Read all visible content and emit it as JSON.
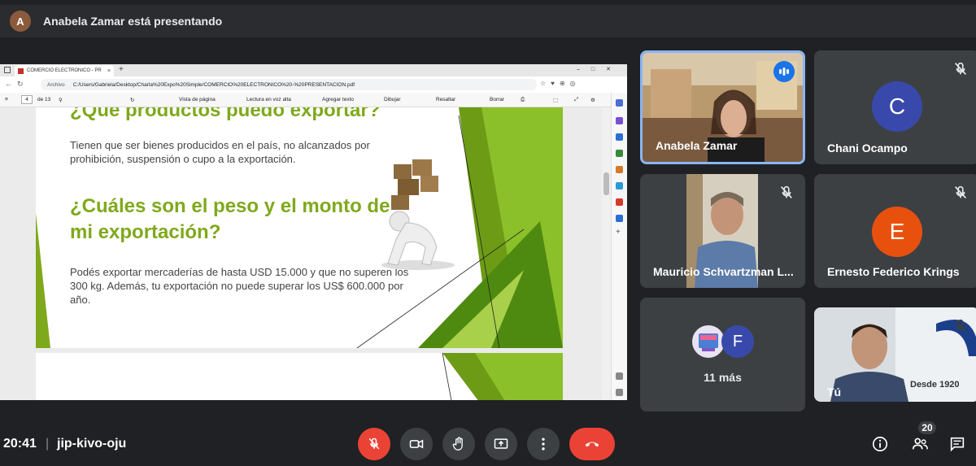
{
  "banner": {
    "avatar_initial": "A",
    "text": "Anabela Zamar está presentando"
  },
  "browser": {
    "tab_title": "COMERCIO ELECTRONICO - PR",
    "tab_close": "×",
    "new_tab": "+",
    "address_label": "Archivo",
    "url": "C:/Users/Gabriela/Desktop/Charla%20Expo%20Simple/COMERCIO%20ELECTRONICO%20-%20PRESENTACION.pdf",
    "page_number": "4",
    "page_total": "de 13",
    "toolbar": {
      "page_view": "Vista de página",
      "read_aloud": "Lectura en voz alta",
      "add_text": "Agregar texto",
      "draw": "Dibujar",
      "highlight": "Resaltar",
      "erase": "Borrar"
    }
  },
  "slide": {
    "title_top": "¿Qué productos puedo exportar?",
    "paragraph1": "Tienen que ser bienes producidos en el país, no alcanzados por prohibición, suspensión o cupo a la exportación.",
    "heading2": "¿Cuáles son el peso y el monto de mi exportación?",
    "paragraph2": "Podés exportar mercaderías de hasta USD 15.000 y que no superen los 300 kg.  Además, tu exportación no puede superar los US$ 600.000 por año."
  },
  "participants": {
    "anabela": {
      "name": "Anabela Zamar"
    },
    "chani": {
      "name": "Chani Ocampo",
      "initial": "C",
      "color": "#3949ab"
    },
    "mauricio": {
      "name": "Mauricio Schvartzman L..."
    },
    "ernesto": {
      "name": "Ernesto Federico Krings",
      "initial": "E",
      "color": "#e8500e"
    },
    "more": {
      "label": "11 más",
      "initial": "F",
      "color": "#3949ab"
    },
    "you": {
      "name": "Tú"
    }
  },
  "bottom": {
    "time": "20:41",
    "separator": "|",
    "meeting_code": "jip-kivo-oju",
    "participant_count": "20"
  }
}
